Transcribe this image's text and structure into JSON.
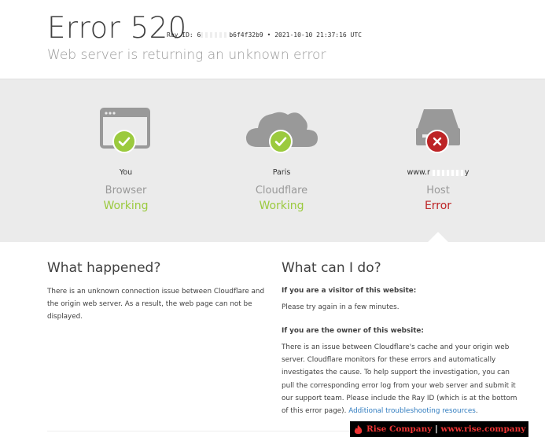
{
  "header": {
    "error_code": "Error 520",
    "ray_prefix": "Ray ID: 6",
    "ray_suffix": "b6f4f32b9",
    "ray_sep": "•",
    "timestamp": "2021-10-10 21:37:16 UTC",
    "subtitle": "Web server is returning an unknown error"
  },
  "status": {
    "browser": {
      "location": "You",
      "name": "Browser",
      "state": "Working",
      "icon": "browser-window-icon",
      "badge": "check-icon"
    },
    "cloudflare": {
      "location": "Paris",
      "name": "Cloudflare",
      "state": "Working",
      "icon": "cloud-icon",
      "badge": "check-icon"
    },
    "host": {
      "location_prefix": "www.r",
      "location_suffix": "y",
      "name": "Host",
      "state": "Error",
      "icon": "server-icon",
      "badge": "x-icon"
    }
  },
  "colors": {
    "working": "#9bca3e",
    "error": "#bd2426",
    "link": "#2f7bbf",
    "band": "#ebebeb"
  },
  "what_happened": {
    "title": "What happened?",
    "lines": [
      "There is an unknown connection issue between Cloudflare and",
      "the origin web server. As a result, the web page can not be",
      "displayed."
    ]
  },
  "what_can_i_do": {
    "title": "What can I do?",
    "visitor_heading": "If you are a visitor of this website:",
    "visitor_text": "Please try again in a few minutes.",
    "owner_heading": "If you are the owner of this website:",
    "owner_lines": [
      "There is an issue between Cloudflare's cache and your origin web",
      "server. Cloudflare monitors for these errors and automatically",
      "investigates the cause. To help support the investigation, you can",
      "pull the corresponding error log from your web server and submit it",
      "our support team. Please include the Ray ID (which is at the bottom"
    ],
    "owner_last_line": "of this error page).",
    "link_text": "Additional troubleshooting resources",
    "link_after": "."
  },
  "watermark": {
    "name": "Rise Company",
    "separator": "|",
    "url": "www.rise.company"
  }
}
